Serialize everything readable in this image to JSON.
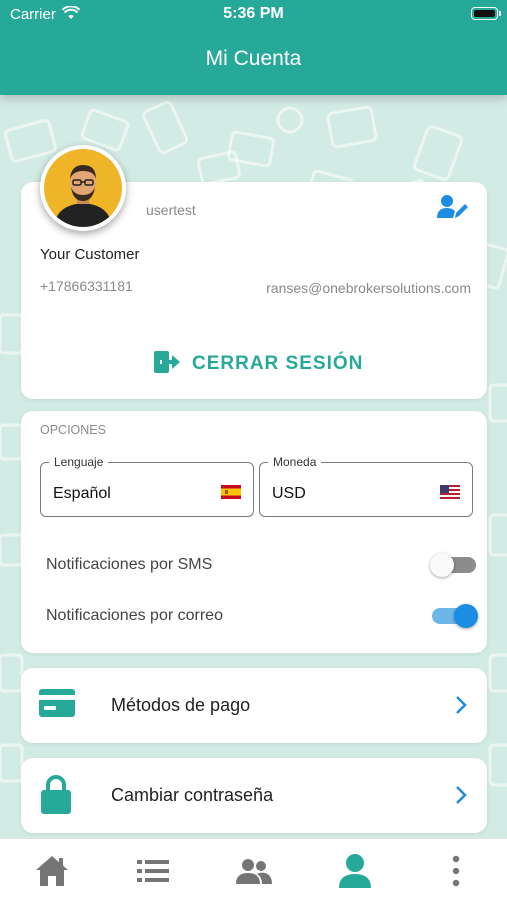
{
  "status_bar": {
    "carrier": "Carrier",
    "time": "5:36 PM"
  },
  "header": {
    "title": "Mi Cuenta"
  },
  "profile": {
    "username": "usertest",
    "full_name": "Your Customer",
    "phone": "+17866331181",
    "email": "ranses@onebrokersolutions.com",
    "logout_label": "CERRAR SESIÓN",
    "avatar_icon": "user-avatar-icon",
    "edit_icon": "edit-user-icon"
  },
  "options": {
    "section_title": "OPCIONES",
    "language": {
      "label": "Lenguaje",
      "value": "Español",
      "flag": "spain-flag-icon"
    },
    "currency": {
      "label": "Moneda",
      "value": "USD",
      "flag": "usa-flag-icon"
    },
    "sms_notifications": {
      "label": "Notificaciones por SMS",
      "enabled": false
    },
    "email_notifications": {
      "label": "Notificaciones por correo",
      "enabled": true
    }
  },
  "menu": [
    {
      "label": "Métodos de pago",
      "icon": "credit-card-icon"
    },
    {
      "label": "Cambiar contraseña",
      "icon": "lock-icon"
    }
  ],
  "bottom_nav": [
    {
      "icon": "home-icon",
      "active": false
    },
    {
      "icon": "list-icon",
      "active": false
    },
    {
      "icon": "users-icon",
      "active": false
    },
    {
      "icon": "account-icon",
      "active": true
    },
    {
      "icon": "more-vertical-icon",
      "active": false
    }
  ],
  "colors": {
    "primary": "#27a99a",
    "accent": "#1b8ee3",
    "background": "#d3ebe5",
    "inactive_icon": "#757575"
  }
}
